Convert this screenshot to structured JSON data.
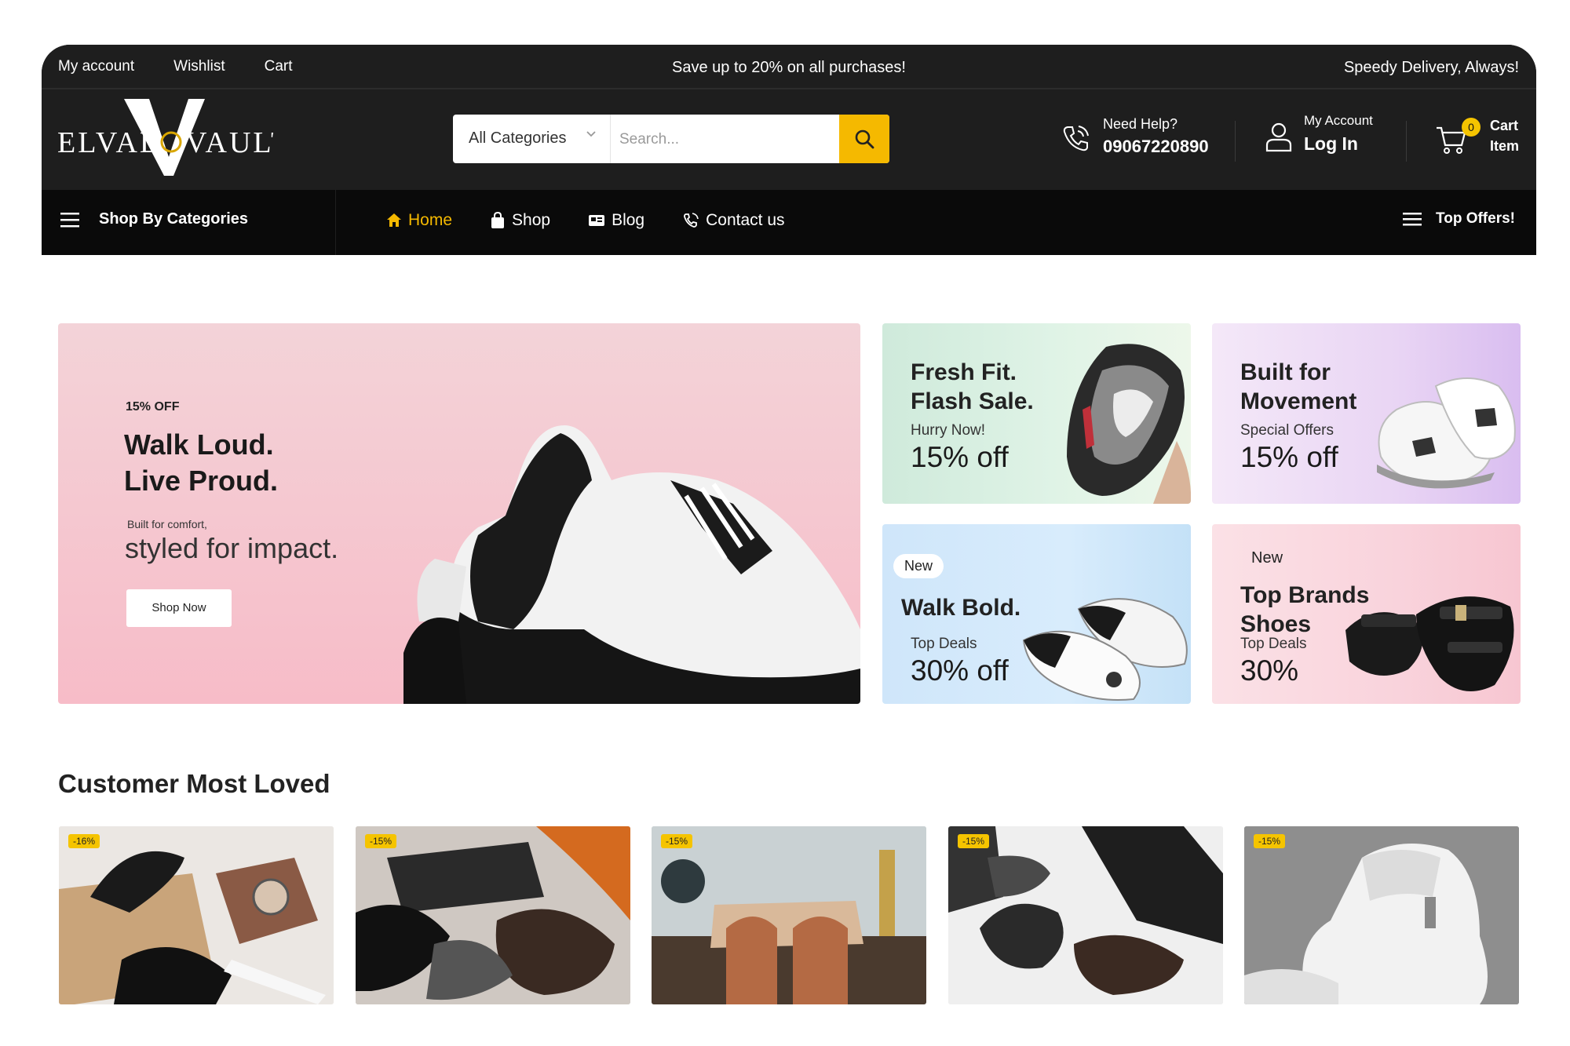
{
  "topbar": {
    "links": [
      "My account",
      "Wishlist",
      "Cart"
    ],
    "promo": "Save up to 20% on all purchases!",
    "delivery": "Speedy Delivery, Always!"
  },
  "brand": {
    "logo_text": "ELVAD VAULT",
    "monogram": "V"
  },
  "search": {
    "category": "All Categories",
    "placeholder": "Search..."
  },
  "help": {
    "label": "Need Help?",
    "phone": "09067220890"
  },
  "account": {
    "label": "My Account",
    "action": "Log In"
  },
  "cart": {
    "count": "0",
    "label1": "Cart",
    "label2": "Item"
  },
  "nav": {
    "categories": "Shop By Categories",
    "links": [
      "Home",
      "Shop",
      "Blog",
      "Contact us"
    ],
    "offers": "Top Offers!"
  },
  "hero": {
    "off": "15% OFF",
    "title1": "Walk Loud.",
    "title2": "Live Proud.",
    "sub": "Built for comfort,",
    "big": "styled for impact.",
    "button": "Shop Now"
  },
  "banners": [
    {
      "title1": "Fresh Fit.",
      "title2": "Flash Sale.",
      "small": "Hurry Now!",
      "pct": "15% off"
    },
    {
      "title1": "Built for",
      "title2": "Movement",
      "small": "Special Offers",
      "pct": "15% off"
    },
    {
      "tag": "New",
      "title1": "Walk Bold.",
      "small": "Top Deals",
      "pct": "30% off"
    },
    {
      "tag": "New",
      "title1": "Top Brands",
      "title2": "Shoes",
      "small": "Top Deals",
      "pct": "30%"
    }
  ],
  "section": {
    "title": "Customer Most Loved"
  },
  "products": [
    {
      "discount": "-16%"
    },
    {
      "discount": "-15%"
    },
    {
      "discount": "-15%"
    },
    {
      "discount": "-15%"
    },
    {
      "discount": "-15%"
    }
  ],
  "colors": {
    "accent": "#f5b900",
    "header_bg": "#1e1e1e",
    "nav_bg": "#0a0a0a"
  }
}
